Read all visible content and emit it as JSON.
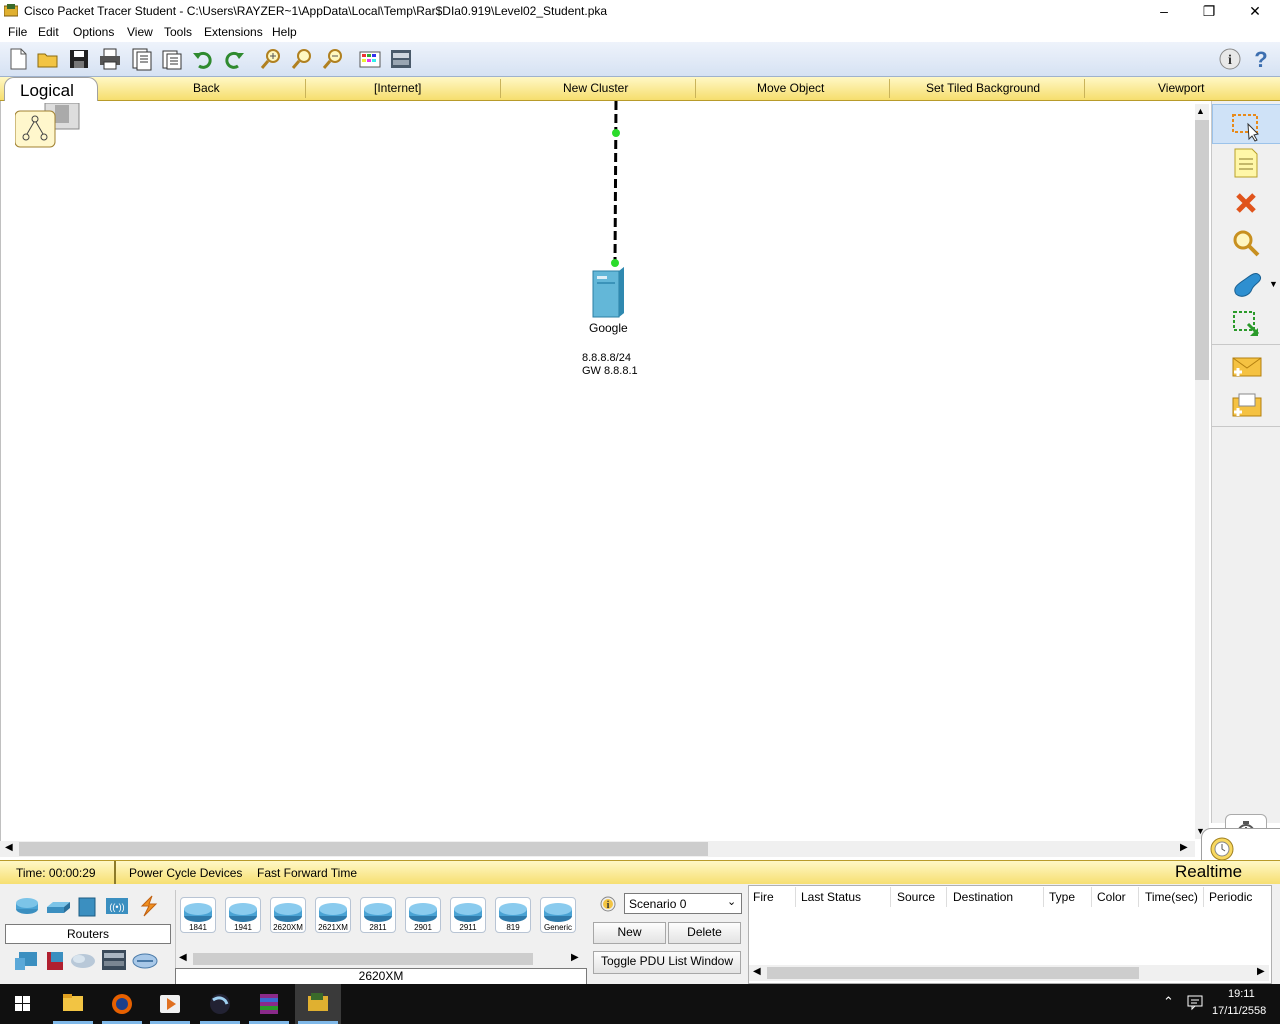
{
  "window": {
    "title": "Cisco Packet Tracer Student - C:\\Users\\RAYZER~1\\AppData\\Local\\Temp\\Rar$DIa0.919\\Level02_Student.pka"
  },
  "menu": [
    "File",
    "Edit",
    "Options",
    "View",
    "Tools",
    "Extensions",
    "Help"
  ],
  "toolbar": {
    "icons": [
      "new-file-icon",
      "open-folder-icon",
      "save-icon",
      "print-icon",
      "activity-wizard-icon",
      "paste-icon",
      "undo-icon",
      "redo-icon",
      "zoom-in-icon",
      "zoom-reset-icon",
      "zoom-out-icon",
      "palette-icon",
      "custom-device-icon"
    ],
    "right_icons": [
      "info-icon",
      "help-icon"
    ]
  },
  "nav": {
    "tab": "Logical",
    "back": "Back",
    "location": "[Internet]",
    "new_cluster": "New Cluster",
    "move_object": "Move Object",
    "tiled_background": "Set Tiled Background",
    "viewport": "Viewport"
  },
  "canvas": {
    "device_label": "Google",
    "ip": "8.8.8.8/24",
    "gateway": "GW 8.8.8.1"
  },
  "palette": [
    "select-icon",
    "note-icon",
    "delete-icon",
    "inspect-icon",
    "draw-shape-icon",
    "resize-icon",
    "simple-pdu-icon",
    "complex-pdu-icon"
  ],
  "status": {
    "time": "Time: 00:00:29",
    "power_cycle": "Power Cycle Devices",
    "fast_forward": "Fast Forward Time",
    "mode": "Realtime"
  },
  "devices": {
    "category_label": "Routers",
    "models": [
      "1841",
      "1941",
      "2620XM",
      "2621XM",
      "2811",
      "2901",
      "2911",
      "819",
      "Generic"
    ],
    "selected": "2620XM"
  },
  "scenario": {
    "selected": "Scenario 0",
    "new": "New",
    "delete": "Delete",
    "toggle": "Toggle PDU List Window"
  },
  "pdu_columns": [
    "Fire",
    "Last Status",
    "Source",
    "Destination",
    "Type",
    "Color",
    "Time(sec)",
    "Periodic"
  ],
  "taskbar": {
    "time": "19:11",
    "date": "17/11/2558"
  }
}
